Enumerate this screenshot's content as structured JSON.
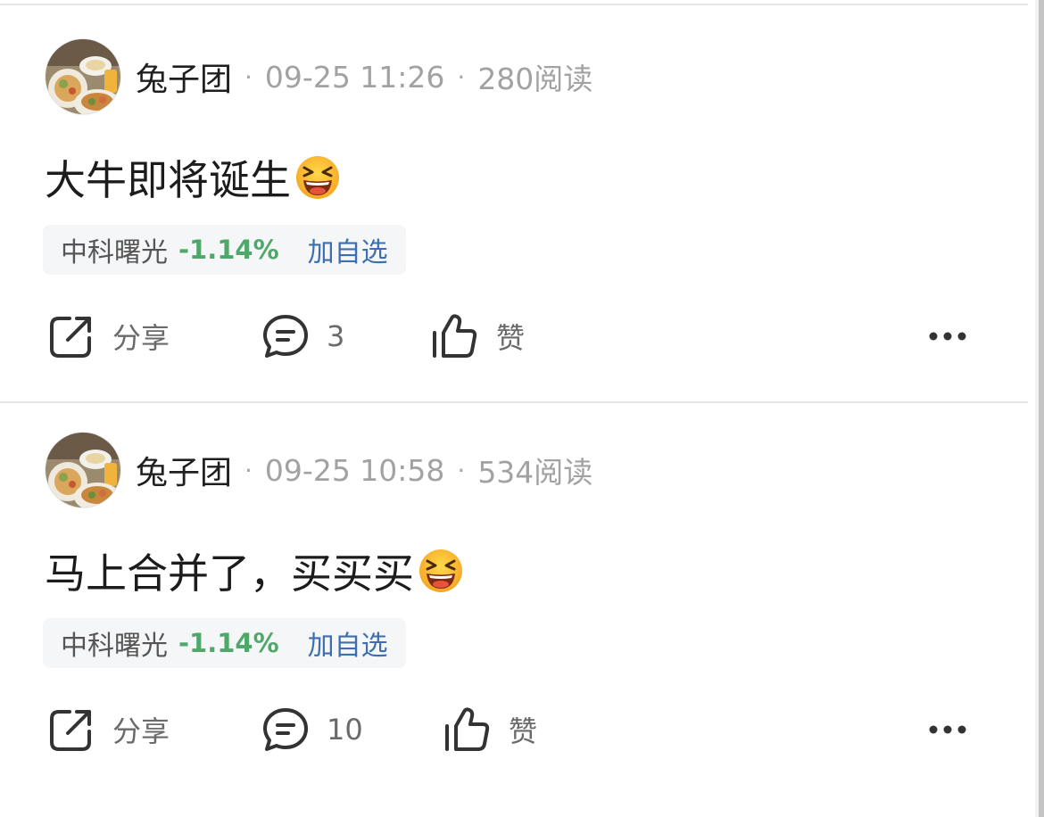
{
  "colors": {
    "stock_down": "#4fa86a",
    "watch_link": "#3d6fb0",
    "meta_gray": "#a2a2a2",
    "chip_bg": "#f5f6f8"
  },
  "posts": [
    {
      "author": "兔子团",
      "separator": "·",
      "time": "09-25 11:26",
      "reads": "280阅读",
      "content": "大牛即将诞生",
      "emoji": "grinning-squinting-face",
      "stock": {
        "name": "中科曙光",
        "change": "-1.14%",
        "watch_label": "加自选"
      },
      "actions": {
        "share": "分享",
        "comments": "3",
        "like": "赞",
        "more": "more-icon"
      }
    },
    {
      "author": "兔子团",
      "separator": "·",
      "time": "09-25 10:58",
      "reads": "534阅读",
      "content": "马上合并了，买买买",
      "emoji": "grinning-squinting-face",
      "stock": {
        "name": "中科曙光",
        "change": "-1.14%",
        "watch_label": "加自选"
      },
      "actions": {
        "share": "分享",
        "comments": "10",
        "like": "赞",
        "more": "more-icon"
      }
    }
  ]
}
